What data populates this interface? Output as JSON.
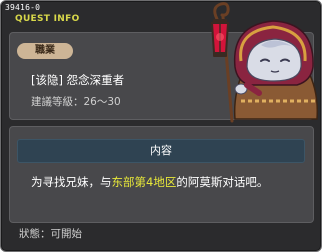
{
  "quest_id": "39416-0",
  "title": "QUEST INFO",
  "job_label": "職業",
  "quest_name": "[该隐] 怨念深重者",
  "level_label": "建議等級：26～30",
  "content_label": "内容",
  "description": {
    "before": "为寻找兄妹，与",
    "highlight": "东部第4地区",
    "after": "的阿莫斯对话吧。"
  },
  "status_label": "狀態：可開始",
  "npc_icon": "hooded-npc-with-lantern-staff",
  "colors": {
    "title": "#d8d84a",
    "highlight": "#e8e83a",
    "job_tag": "#cdb596",
    "content_header": "#2f4352"
  }
}
